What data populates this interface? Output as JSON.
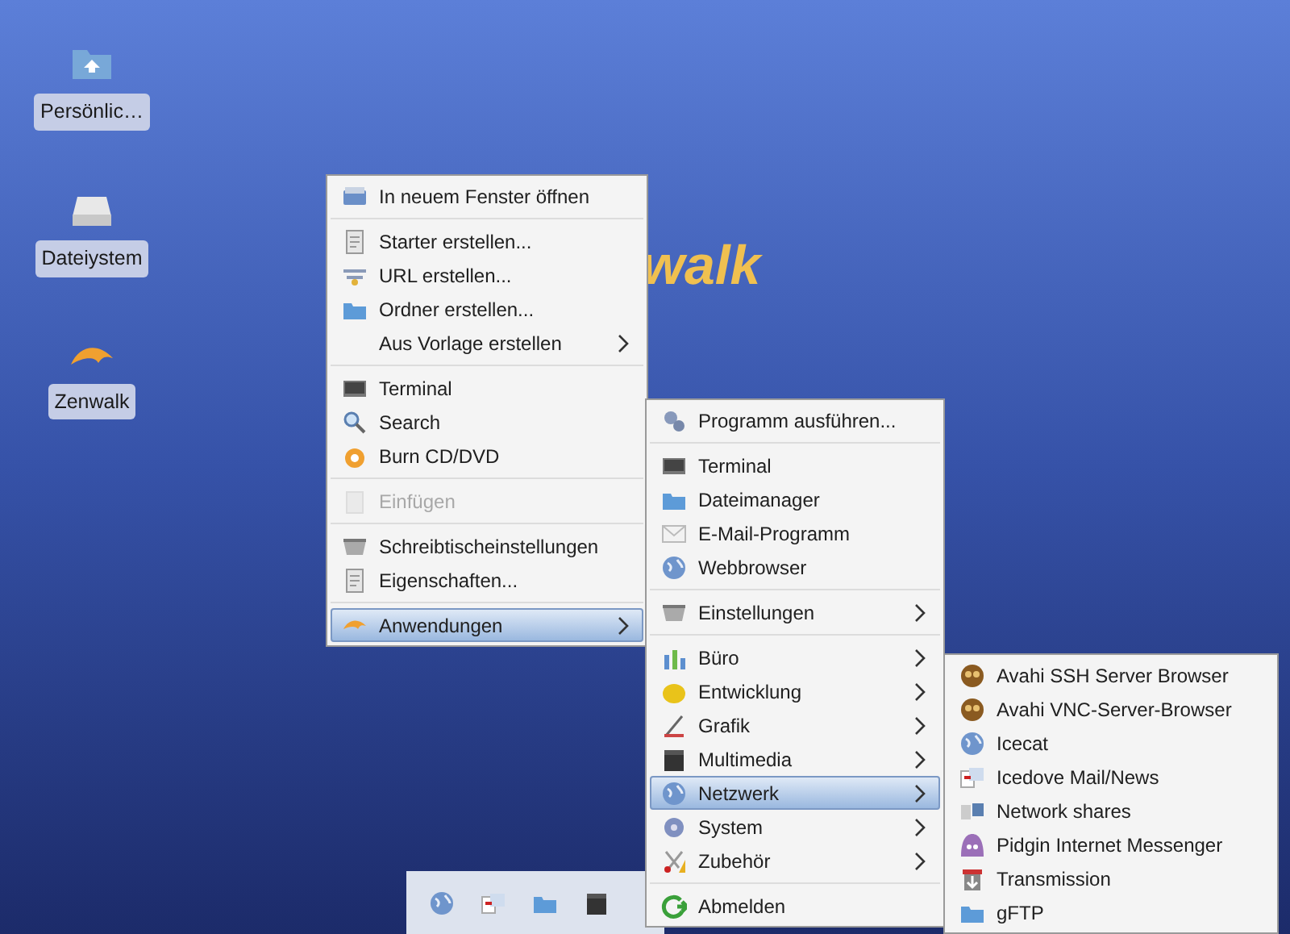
{
  "desktop_icons": [
    {
      "label": "Persönlic…"
    },
    {
      "label": "Dateiystem"
    },
    {
      "label": "Zenwalk"
    }
  ],
  "logo_text": "walk",
  "menus": [
    {
      "sections": [
        [
          {
            "label": "In neuem Fenster öffnen",
            "selected": false,
            "disabled": false,
            "submenu": false
          }
        ],
        [
          {
            "label": "Starter erstellen...",
            "selected": false,
            "disabled": false,
            "submenu": false
          },
          {
            "label": "URL erstellen...",
            "selected": false,
            "disabled": false,
            "submenu": false
          },
          {
            "label": "Ordner erstellen...",
            "selected": false,
            "disabled": false,
            "submenu": false
          },
          {
            "label": "Aus Vorlage erstellen",
            "selected": false,
            "disabled": false,
            "submenu": true
          }
        ],
        [
          {
            "label": "Terminal",
            "selected": false,
            "disabled": false,
            "submenu": false
          },
          {
            "label": "Search",
            "selected": false,
            "disabled": false,
            "submenu": false
          },
          {
            "label": "Burn CD/DVD",
            "selected": false,
            "disabled": false,
            "submenu": false
          }
        ],
        [
          {
            "label": "Einfügen",
            "selected": false,
            "disabled": true,
            "submenu": false
          }
        ],
        [
          {
            "label": "Schreibtischeinstellungen",
            "selected": false,
            "disabled": false,
            "submenu": false
          },
          {
            "label": "Eigenschaften...",
            "selected": false,
            "disabled": false,
            "submenu": false
          }
        ],
        [
          {
            "label": "Anwendungen",
            "selected": true,
            "disabled": false,
            "submenu": true
          }
        ]
      ]
    },
    {
      "sections": [
        [
          {
            "label": "Programm ausführen...",
            "selected": false,
            "disabled": false,
            "submenu": false
          }
        ],
        [
          {
            "label": "Terminal",
            "selected": false,
            "disabled": false,
            "submenu": false
          },
          {
            "label": "Dateimanager",
            "selected": false,
            "disabled": false,
            "submenu": false
          },
          {
            "label": "E-Mail-Programm",
            "selected": false,
            "disabled": false,
            "submenu": false
          },
          {
            "label": "Webbrowser",
            "selected": false,
            "disabled": false,
            "submenu": false
          }
        ],
        [
          {
            "label": "Einstellungen",
            "selected": false,
            "disabled": false,
            "submenu": true
          }
        ],
        [
          {
            "label": "Büro",
            "selected": false,
            "disabled": false,
            "submenu": true
          },
          {
            "label": "Entwicklung",
            "selected": false,
            "disabled": false,
            "submenu": true
          },
          {
            "label": "Grafik",
            "selected": false,
            "disabled": false,
            "submenu": true
          },
          {
            "label": "Multimedia",
            "selected": false,
            "disabled": false,
            "submenu": true
          },
          {
            "label": "Netzwerk",
            "selected": true,
            "disabled": false,
            "submenu": true
          },
          {
            "label": "System",
            "selected": false,
            "disabled": false,
            "submenu": true
          },
          {
            "label": "Zubehör",
            "selected": false,
            "disabled": false,
            "submenu": true
          }
        ],
        [
          {
            "label": "Abmelden",
            "selected": false,
            "disabled": false,
            "submenu": false
          }
        ]
      ]
    },
    {
      "sections": [
        [
          {
            "label": "Avahi SSH Server Browser",
            "selected": false,
            "disabled": false,
            "submenu": false
          },
          {
            "label": "Avahi VNC-Server-Browser",
            "selected": false,
            "disabled": false,
            "submenu": false
          },
          {
            "label": "Icecat",
            "selected": false,
            "disabled": false,
            "submenu": false
          },
          {
            "label": "Icedove Mail/News",
            "selected": false,
            "disabled": false,
            "submenu": false
          },
          {
            "label": "Network shares",
            "selected": false,
            "disabled": false,
            "submenu": false
          },
          {
            "label": "Pidgin Internet Messenger",
            "selected": false,
            "disabled": false,
            "submenu": false
          },
          {
            "label": "Transmission",
            "selected": false,
            "disabled": false,
            "submenu": false
          },
          {
            "label": "gFTP",
            "selected": false,
            "disabled": false,
            "submenu": false
          }
        ]
      ]
    }
  ]
}
